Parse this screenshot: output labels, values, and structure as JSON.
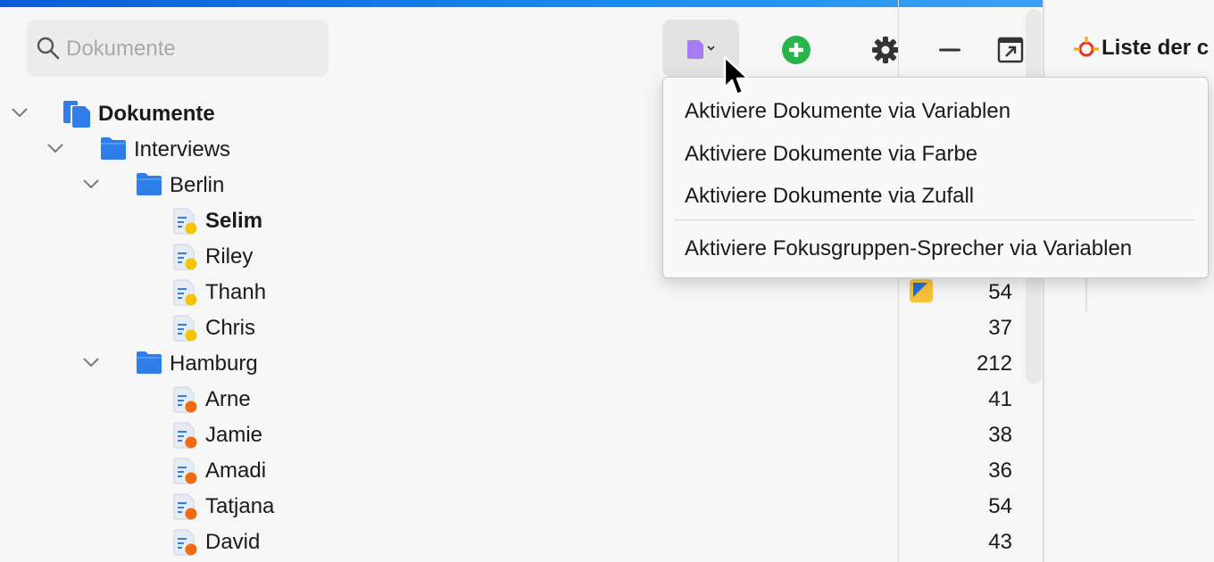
{
  "search": {
    "placeholder": "Dokumente"
  },
  "toolbar": {
    "doc_menu_icon": "document-purple-icon",
    "add_icon": "plus-circle-green-icon",
    "settings_icon": "gear-icon",
    "minimize_icon": "minus-icon",
    "popout_icon": "popout-icon"
  },
  "tree": {
    "root": {
      "label": "Dokumente"
    },
    "groups": [
      {
        "label": "Interviews"
      },
      {
        "label": "Berlin"
      },
      {
        "label": "Hamburg"
      }
    ],
    "docs": [
      {
        "label": "Selim",
        "bold": true,
        "status_color": "#f5c400"
      },
      {
        "label": "Riley",
        "status_color": "#f5c400"
      },
      {
        "label": "Thanh",
        "status_color": "#f5c400"
      },
      {
        "label": "Chris",
        "status_color": "#f5c400"
      },
      {
        "label": "Arne",
        "status_color": "#f26b0f"
      },
      {
        "label": "Jamie",
        "status_color": "#f26b0f"
      },
      {
        "label": "Amadi",
        "status_color": "#f26b0f"
      },
      {
        "label": "Tatjana",
        "status_color": "#f26b0f"
      },
      {
        "label": "David",
        "status_color": "#f26b0f"
      }
    ]
  },
  "counts": {
    "thanh": "54",
    "chris": "37",
    "hamburg": "212",
    "arne": "41",
    "jamie": "38",
    "amadi": "36",
    "tatjana": "54",
    "david": "43"
  },
  "menu": {
    "items": [
      "Aktiviere Dokumente via Variablen",
      "Aktiviere Dokumente via Farbe",
      "Aktiviere Dokumente via Zufall",
      "Aktiviere Fokusgruppen-Sprecher via Variablen"
    ]
  },
  "right_panel": {
    "title": "Liste der c"
  },
  "colors": {
    "accent_blue": "#2e7de9",
    "yellow": "#f5c400",
    "orange": "#f26b0f",
    "green": "#28b44a",
    "purple": "#9b6cf0"
  }
}
